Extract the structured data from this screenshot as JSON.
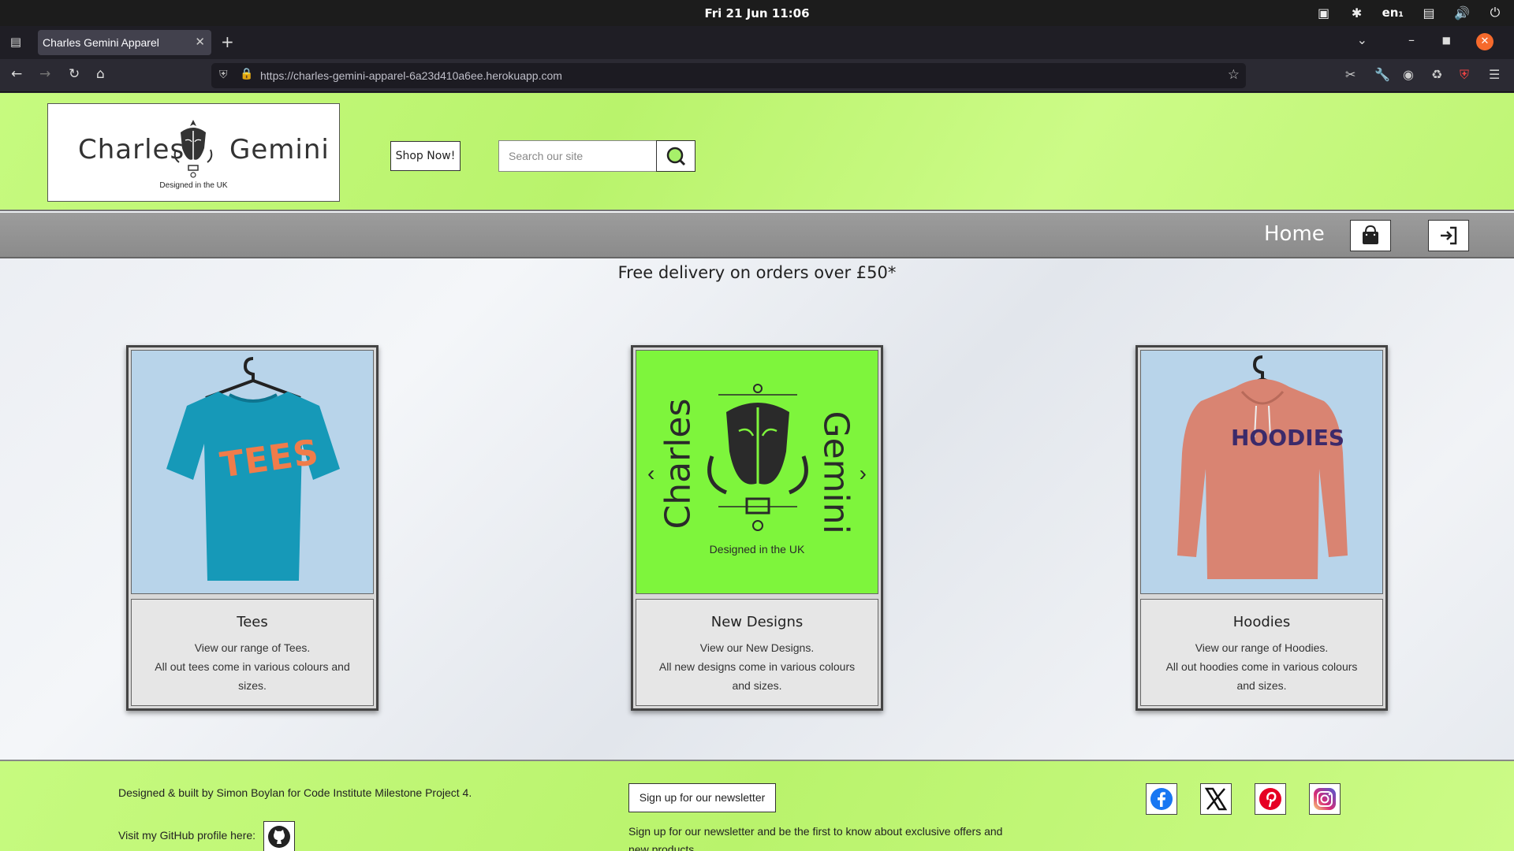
{
  "system": {
    "datetime": "Fri 21 Jun  11:06",
    "lang": "en₁"
  },
  "browser": {
    "tab_title": "Charles Gemini Apparel",
    "url_host": "https://charles-gemini-apparel-6a23d410a6ee.herokuapp.com"
  },
  "header": {
    "logo_left": "Charles",
    "logo_right": "Gemini",
    "logo_tagline": "Designed in the UK",
    "shop_now": "Shop Now!",
    "search_placeholder": "Search our site"
  },
  "menu": {
    "home": "Home"
  },
  "promo": "Free delivery on orders over £50*",
  "cards": [
    {
      "image_text": "TEES",
      "title": "Tees",
      "line1": "View our range of Tees.",
      "line2": "All out tees come in various colours and sizes."
    },
    {
      "image_left": "Charles",
      "image_right": "Gemini",
      "image_tagline": "Designed in the UK",
      "title": "New Designs",
      "line1": "View our New Designs.",
      "line2": "All new designs come in various colours and sizes."
    },
    {
      "image_text": "HOODIES",
      "title": "Hoodies",
      "line1": "View our range of Hoodies.",
      "line2": "All out hoodies come in various colours and sizes."
    }
  ],
  "footer": {
    "credit": "Designed & built by Simon Boylan for Code Institute Milestone Project 4.",
    "github_label": "Visit my GitHub profile here:",
    "newsletter_button": "Sign up for our newsletter",
    "newsletter_text": "Sign up for our newsletter and be the first to know about exclusive offers and new products."
  },
  "icons": {
    "social": [
      "facebook-icon",
      "x-icon",
      "pinterest-icon",
      "instagram-icon"
    ]
  },
  "colors": {
    "header_green": "#c6fa7f",
    "new_designs_green": "#7ef53c",
    "tees_blue": "#1699b8",
    "tee_print_orange": "#f07c4a",
    "hoodie_pink": "#d98472",
    "card_bg_blue": "#b8d4ea"
  }
}
